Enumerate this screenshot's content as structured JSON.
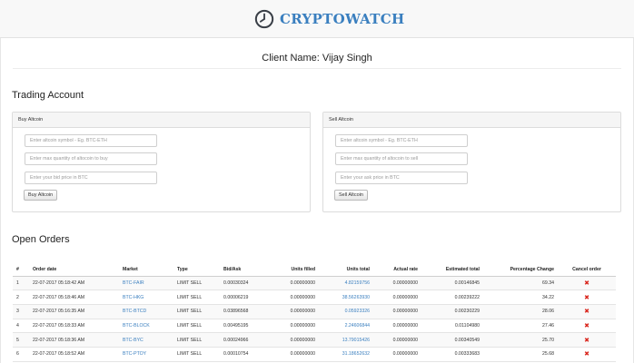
{
  "app": {
    "brand": "CRYPTOWATCH"
  },
  "colors": {
    "brand": "#3a7fbf",
    "link": "#3a7fbf",
    "cancel": "#d9251c"
  },
  "icons": {
    "logo": "clock-icon",
    "cancel": "close-icon"
  },
  "client": {
    "name": "Client Name: Vijay Singh"
  },
  "trading": {
    "title": "Trading Account",
    "buy": {
      "heading": "Buy Altcoin",
      "symbol_placeholder": "Enter altcoin symbol - Eg. BTC-ETH",
      "quantity_placeholder": "Enter max quantity of altocoin to buy",
      "price_placeholder": "Enter your bid price in BTC",
      "button": "Buy Altcoin"
    },
    "sell": {
      "heading": "Sell Altcoin",
      "symbol_placeholder": "Enter altcoin symbol - Eg. BTC-ETH",
      "quantity_placeholder": "Enter max quantity of altocoin to sell",
      "price_placeholder": "Enter your ask price in BTC",
      "button": "Sell Altcoin"
    }
  },
  "orders": {
    "title": "Open Orders",
    "columns": [
      "#",
      "Order date",
      "Market",
      "Type",
      "Bid/Ask",
      "Units filled",
      "Units total",
      "Actual rate",
      "Estimated total",
      "Percentage Change",
      "Cancel order"
    ],
    "rows": [
      [
        "1",
        "22-07-2017 05:18:42 AM",
        "BTC-FAIR",
        "LIMIT SELL",
        "0.00030324",
        "0.00000000",
        "4.82159756",
        "0.00000000",
        "0.00146845",
        "69.34",
        "✖"
      ],
      [
        "2",
        "22-07-2017 05:18:46 AM",
        "BTC-HKG",
        "LIMIT SELL",
        "0.00006219",
        "0.00000000",
        "38.56263930",
        "0.00000000",
        "0.00239222",
        "34.22",
        "✖"
      ],
      [
        "3",
        "22-07-2017 05:16:35 AM",
        "BTC-BTCD",
        "LIMIT SELL",
        "0.03896568",
        "0.00000000",
        "0.05923326",
        "0.00000000",
        "0.00230229",
        "28.06",
        "✖"
      ],
      [
        "4",
        "22-07-2017 05:18:33 AM",
        "BTC-BLOCK",
        "LIMIT SELL",
        "0.00495195",
        "0.00000000",
        "2.24606844",
        "0.00000000",
        "0.01104980",
        "27.46",
        "✖"
      ],
      [
        "5",
        "22-07-2017 05:18:36 AM",
        "BTC-BYC",
        "LIMIT SELL",
        "0.00024966",
        "0.00000000",
        "13.79015426",
        "0.00000000",
        "0.00340549",
        "25.70",
        "✖"
      ],
      [
        "6",
        "22-07-2017 05:18:52 AM",
        "BTC-PTOY",
        "LIMIT SELL",
        "0.00010754",
        "0.00000000",
        "31.18652632",
        "0.00000000",
        "0.00333683",
        "25.68",
        "✖"
      ]
    ]
  }
}
